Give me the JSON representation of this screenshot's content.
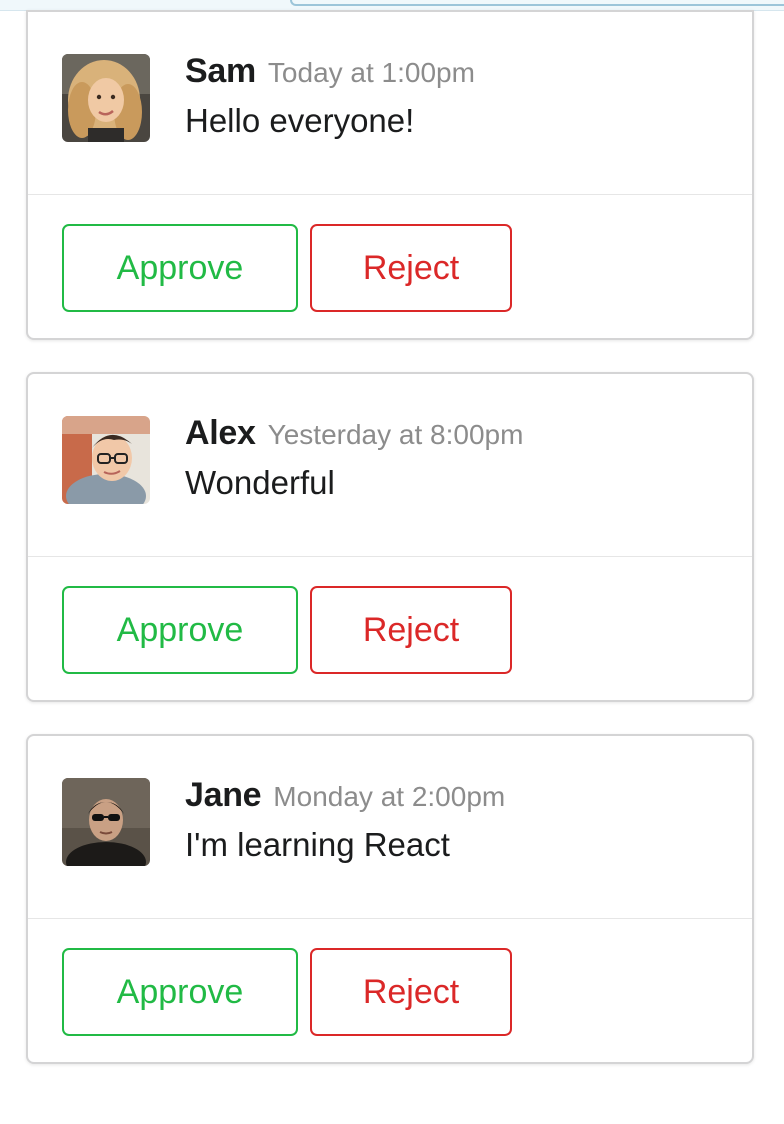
{
  "colors": {
    "approve": "#21ba45",
    "reject": "#db2828",
    "author": "#1b1c1d",
    "timestamp": "#8c8c8c",
    "card_border": "#d4d4d5"
  },
  "comments": [
    {
      "author": "Sam",
      "timestamp": "Today at 1:00pm",
      "text": "Hello everyone!",
      "avatar_icon": "user-avatar-sam",
      "approve_label": "Approve",
      "reject_label": "Reject"
    },
    {
      "author": "Alex",
      "timestamp": "Yesterday at 8:00pm",
      "text": "Wonderful",
      "avatar_icon": "user-avatar-alex",
      "approve_label": "Approve",
      "reject_label": "Reject"
    },
    {
      "author": "Jane",
      "timestamp": "Monday at 2:00pm",
      "text": "I'm learning React",
      "avatar_icon": "user-avatar-jane",
      "approve_label": "Approve",
      "reject_label": "Reject"
    }
  ]
}
